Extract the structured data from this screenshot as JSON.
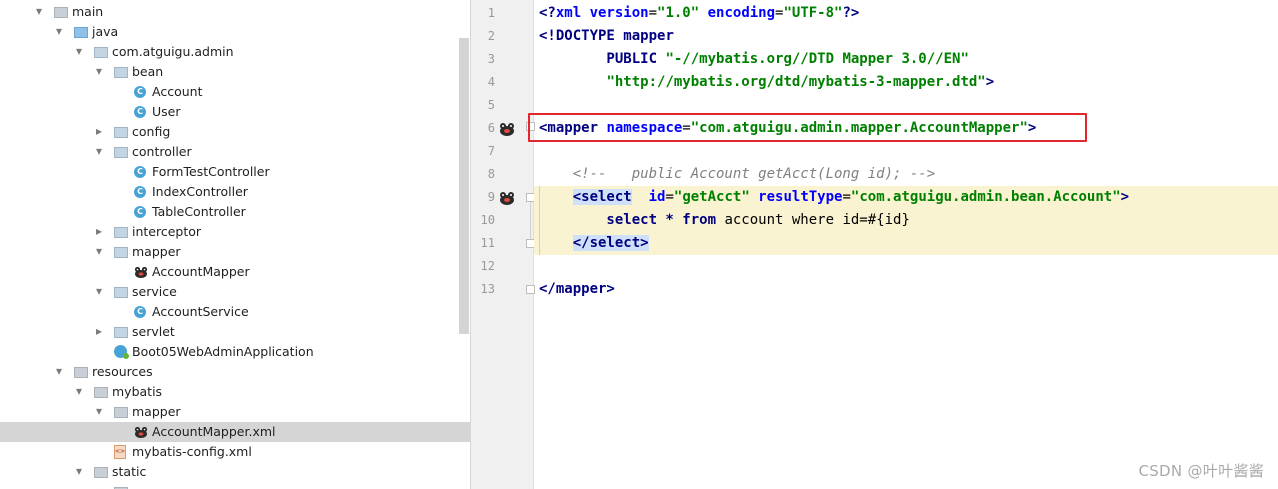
{
  "project_tree": {
    "rows": [
      {
        "label": "main",
        "icon": "folder-icon",
        "level": 0,
        "expanded": true
      },
      {
        "label": "java",
        "icon": "source-folder-icon",
        "level": 1,
        "expanded": true
      },
      {
        "label": "com.atguigu.admin",
        "icon": "package-icon",
        "level": 2,
        "expanded": true
      },
      {
        "label": "bean",
        "icon": "package-icon",
        "level": 3,
        "expanded": true
      },
      {
        "label": "Account",
        "icon": "java-class-icon",
        "level": 4
      },
      {
        "label": "User",
        "icon": "java-class-icon",
        "level": 4
      },
      {
        "label": "config",
        "icon": "package-icon",
        "level": 3,
        "expanded": false
      },
      {
        "label": "controller",
        "icon": "package-icon",
        "level": 3,
        "expanded": true
      },
      {
        "label": "FormTestController",
        "icon": "java-class-icon",
        "level": 4
      },
      {
        "label": "IndexController",
        "icon": "java-class-icon",
        "level": 4
      },
      {
        "label": "TableController",
        "icon": "java-class-icon",
        "level": 4
      },
      {
        "label": "interceptor",
        "icon": "package-icon",
        "level": 3,
        "expanded": false
      },
      {
        "label": "mapper",
        "icon": "package-icon",
        "level": 3,
        "expanded": true
      },
      {
        "label": "AccountMapper",
        "icon": "mybatis-icon",
        "level": 4
      },
      {
        "label": "service",
        "icon": "package-icon",
        "level": 3,
        "expanded": true
      },
      {
        "label": "AccountService",
        "icon": "java-class-icon",
        "level": 4
      },
      {
        "label": "servlet",
        "icon": "package-icon",
        "level": 3,
        "expanded": false
      },
      {
        "label": "Boot05WebAdminApplication",
        "icon": "spring-app-icon",
        "level": 3
      },
      {
        "label": "resources",
        "icon": "resources-folder-icon",
        "level": 1,
        "expanded": true
      },
      {
        "label": "mybatis",
        "icon": "folder-icon",
        "level": 2,
        "expanded": true
      },
      {
        "label": "mapper",
        "icon": "folder-icon",
        "level": 3,
        "expanded": true
      },
      {
        "label": "AccountMapper.xml",
        "icon": "mybatis-icon",
        "level": 4,
        "selected": true
      },
      {
        "label": "mybatis-config.xml",
        "icon": "xml-file-icon",
        "level": 3
      },
      {
        "label": "static",
        "icon": "folder-icon",
        "level": 2,
        "expanded": true
      },
      {
        "label": "",
        "icon": "folder-icon",
        "level": 3,
        "expanded": false
      }
    ]
  },
  "editor": {
    "line_numbers": [
      "1",
      "2",
      "3",
      "4",
      "5",
      "6",
      "7",
      "8",
      "9",
      "10",
      "11",
      "12",
      "13"
    ],
    "lines": {
      "l1": {
        "p1": "<?",
        "p2": "xml version",
        "p3": "=",
        "p4": "\"1.0\"",
        "p5": " encoding",
        "p6": "=",
        "p7": "\"UTF-8\"",
        "p8": "?>"
      },
      "l2": {
        "p1": "<!DOCTYPE ",
        "p2": "mapper"
      },
      "l3": {
        "p1": "        PUBLIC ",
        "p2": "\"-//mybatis.org//DTD Mapper 3.0//EN\""
      },
      "l4": {
        "p1": "        ",
        "p2": "\"http://mybatis.org/dtd/mybatis-3-mapper.dtd\"",
        "p3": ">"
      },
      "l6": {
        "p1": "<mapper ",
        "p2": "namespace",
        "p3": "=",
        "p4": "\"com.atguigu.admin.mapper.AccountMapper\"",
        "p5": ">"
      },
      "l8": {
        "p1": "    <!--   public Account getAcct(Long id); -->"
      },
      "l9": {
        "p0": "    ",
        "p1": "<select",
        "p2": "  id",
        "p3": "=",
        "p4": "\"getAcct\"",
        "p5": " resultType",
        "p6": "=",
        "p7": "\"com.atguigu.admin.bean.Account\"",
        "p8": ">"
      },
      "l10": {
        "p1": "        select * from ",
        "p2": "account",
        "p3": " where id=#{id}"
      },
      "l11": {
        "p0": "    ",
        "p1": "</select>"
      },
      "l13": {
        "p1": "</mapper>"
      }
    }
  },
  "watermark": "CSDN @叶叶酱酱",
  "colors": {
    "tag": "#000080",
    "attribute": "#0000ff",
    "string": "#008000",
    "comment": "#808080",
    "highlight_box": "#e2262e",
    "current_block_bg": "#faf3d1",
    "selection": "#d5d5d5"
  }
}
